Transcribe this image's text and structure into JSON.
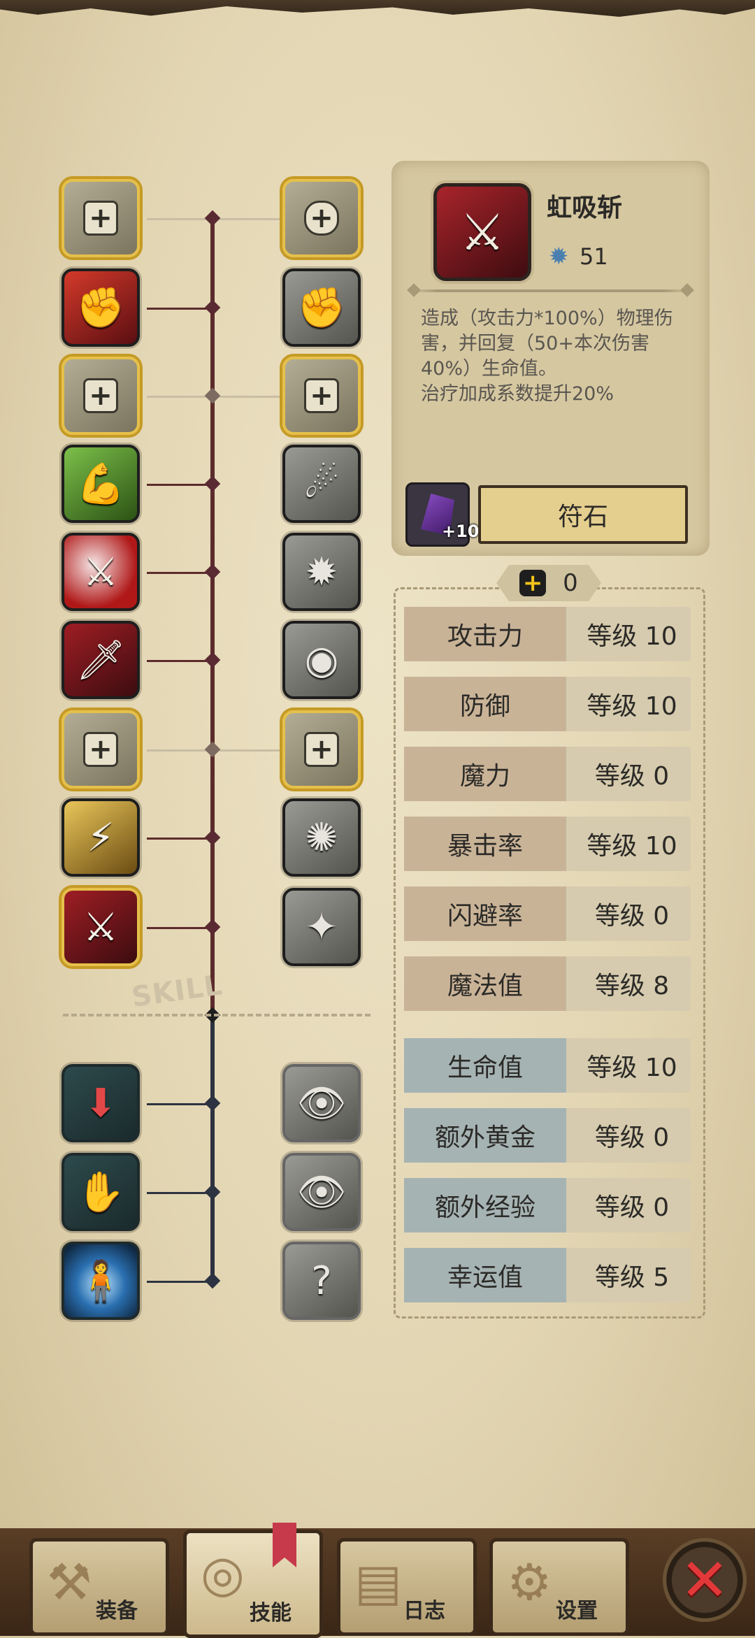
{
  "skill_detail": {
    "name": "虹吸斩",
    "level": "51",
    "description": [
      "造成（攻击力*100%）物理伤",
      "害，并回复（50+本次伤害",
      "40%）生命值。",
      "治疗加成系数提升20%"
    ],
    "rune_count": "+10",
    "rune_button": "符石"
  },
  "points": {
    "available": "0"
  },
  "stats": [
    {
      "name": "攻击力",
      "level": "等级 10"
    },
    {
      "name": "防御",
      "level": "等级 10"
    },
    {
      "name": "魔力",
      "level": "等级 0"
    },
    {
      "name": "暴击率",
      "level": "等级 10"
    },
    {
      "name": "闪避率",
      "level": "等级 0"
    },
    {
      "name": "魔法值",
      "level": "等级 8"
    },
    {
      "name": "生命值",
      "level": "等级 10"
    },
    {
      "name": "额外黄金",
      "level": "等级 0"
    },
    {
      "name": "额外经验",
      "level": "等级 0"
    },
    {
      "name": "幸运值",
      "level": "等级 5"
    }
  ],
  "tree": {
    "section_label": "SKILL"
  },
  "nav": {
    "equipment": "装备",
    "skills": "技能",
    "log": "日志",
    "settings": "设置"
  },
  "colors": {
    "accent_gold": "#e5c04a",
    "close_red": "#e2383a",
    "panel_bg": "#d5c7a0"
  }
}
